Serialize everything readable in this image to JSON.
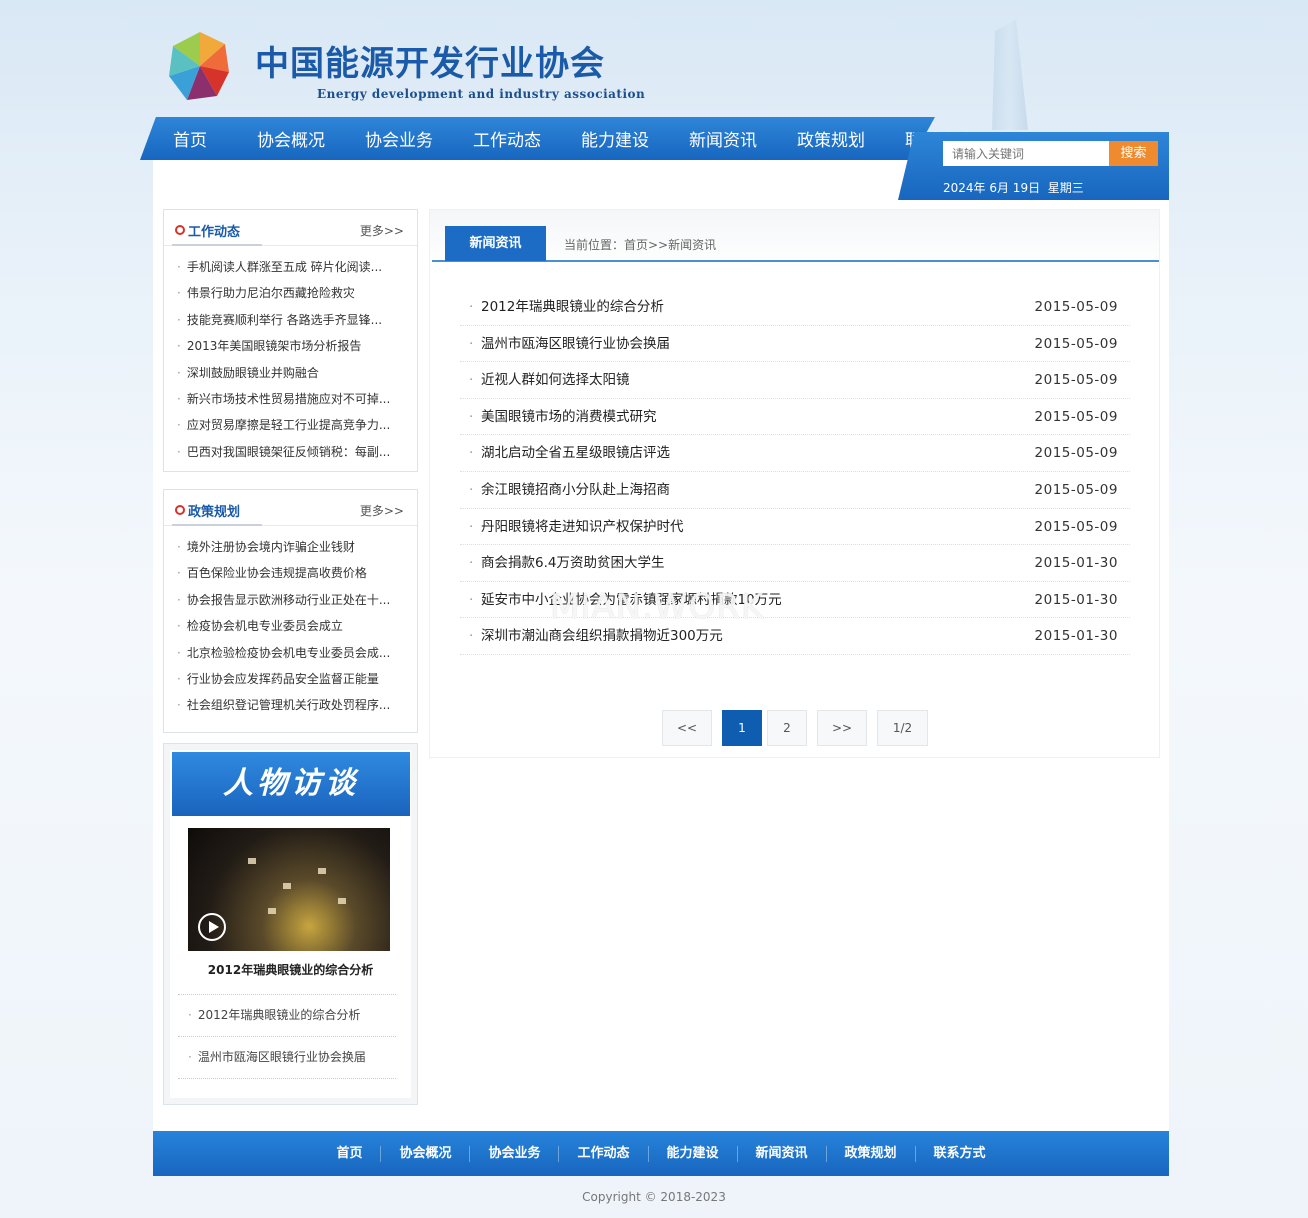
{
  "header": {
    "title": "中国能源开发行业协会",
    "subtitle": "Energy development and industry association"
  },
  "nav": [
    "首页",
    "协会概况",
    "协会业务",
    "工作动态",
    "能力建设",
    "新闻资讯",
    "政策规划",
    "联系方式"
  ],
  "search": {
    "placeholder": "请输入关键词",
    "button": "搜索"
  },
  "date": {
    "text": "2024年 6月 19日",
    "weekday": "星期三"
  },
  "sidebar": {
    "work": {
      "title": "工作动态",
      "more": "更多>>",
      "items": [
        "手机阅读人群涨至五成 碎片化阅读...",
        "伟景行助力尼泊尔西藏抢险救灾",
        "技能竞赛顺利举行 各路选手齐显锋...",
        "2013年美国眼镜架市场分析报告",
        "深圳鼓励眼镜业并购融合",
        "新兴市场技术性贸易措施应对不可掉...",
        "应对贸易摩擦是轻工行业提高竞争力...",
        "巴西对我国眼镜架征反倾销税：每副..."
      ]
    },
    "policy": {
      "title": "政策规划",
      "more": "更多>>",
      "items": [
        "境外注册协会境内诈骗企业钱财",
        "百色保险业协会违规提高收费价格",
        "协会报告显示欧洲移动行业正处在十...",
        "检疫协会机电专业委员会成立",
        "北京检验检疫协会机电专业委员会成...",
        "行业协会应发挥药品安全监督正能量",
        "社会组织登记管理机关行政处罚程序..."
      ]
    },
    "interview": {
      "banner": "人物访谈",
      "caption": "2012年瑞典眼镜业的综合分析",
      "items": [
        "2012年瑞典眼镜业的综合分析",
        "温州市瓯海区眼镜行业协会换届"
      ]
    }
  },
  "main": {
    "tab": "新闻资讯",
    "breadcrumb": "当前位置：首页>>新闻资讯",
    "news": [
      {
        "title": "2012年瑞典眼镜业的综合分析",
        "date": "2015-05-09"
      },
      {
        "title": "温州市瓯海区眼镜行业协会换届",
        "date": "2015-05-09"
      },
      {
        "title": "近视人群如何选择太阳镜",
        "date": "2015-05-09"
      },
      {
        "title": "美国眼镜市场的消费模式研究",
        "date": "2015-05-09"
      },
      {
        "title": "湖北启动全省五星级眼镜店评选",
        "date": "2015-05-09"
      },
      {
        "title": "余江眼镜招商小分队赴上海招商",
        "date": "2015-05-09"
      },
      {
        "title": "丹阳眼镜将走进知识产权保护时代",
        "date": "2015-05-09"
      },
      {
        "title": "商会捐款6.4万资助贫困大学生",
        "date": "2015-01-30"
      },
      {
        "title": "延安市中小企业协会为雷赤镇强家塬村捐款10万元",
        "date": "2015-01-30"
      },
      {
        "title": "深圳市潮汕商会组织捐款捐物近300万元",
        "date": "2015-01-30"
      }
    ],
    "pager": {
      "prev": "<<",
      "pages": [
        "1",
        "2"
      ],
      "current": "1",
      "next": ">>",
      "count": "1/2"
    }
  },
  "watermark": "MIAN.WORK",
  "footer": {
    "nav": [
      "首页",
      "协会概况",
      "协会业务",
      "工作动态",
      "能力建设",
      "新闻资讯",
      "政策规划",
      "联系方式"
    ],
    "copyright": "Copyright © 2018-2023"
  },
  "colors": {
    "primary": "#1766bf",
    "accent": "#f08a2e",
    "title": "#1a5aa8",
    "ring": "#d6332b"
  }
}
